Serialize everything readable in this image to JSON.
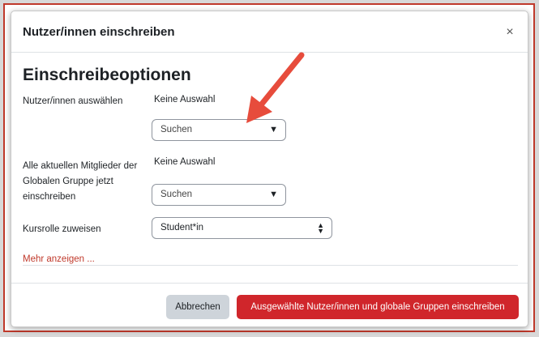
{
  "dialog": {
    "title": "Nutzer/innen einschreiben",
    "close_glyph": "×"
  },
  "section": {
    "title": "Einschreibeoptionen"
  },
  "users": {
    "label": "Nutzer/innen auswählen",
    "selection": "Keine Auswahl",
    "search_text": "Suchen"
  },
  "cohorts": {
    "label": "Alle aktuellen Mitglieder der Globalen Gruppe jetzt einschreiben",
    "selection": "Keine Auswahl",
    "search_text": "Suchen"
  },
  "role": {
    "label": "Kursrolle zuweisen",
    "selected": "Student*in"
  },
  "more_link": "Mehr anzeigen ...",
  "footer": {
    "cancel_label": "Abbrechen",
    "enrol_label": "Ausgewählte Nutzer/innen und globale Gruppen einschreiben"
  },
  "colors": {
    "accent": "#d0262b",
    "annotation_arrow": "#e74c3c"
  },
  "icons": {
    "dropdown": "triangle-down-icon",
    "select": "up-down-chevron-icon",
    "close": "close-icon"
  }
}
